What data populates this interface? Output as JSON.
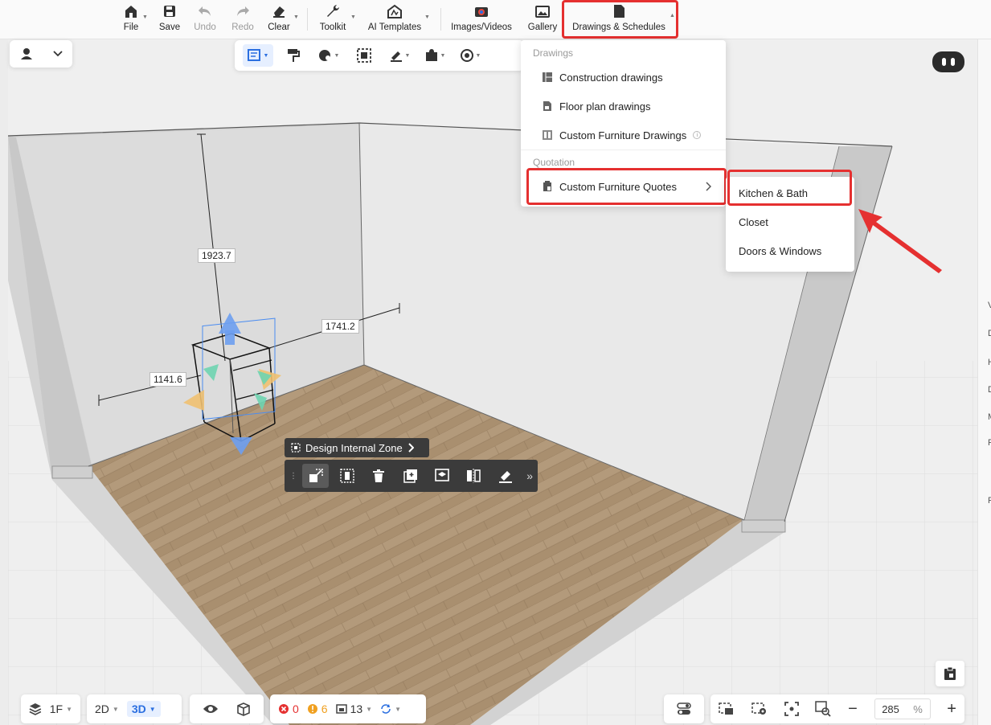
{
  "toolbar": {
    "file": "File",
    "save": "Save",
    "undo": "Undo",
    "redo": "Redo",
    "clear": "Clear",
    "toolkit": "Toolkit",
    "ai_templates": "AI Templates",
    "images_videos": "Images/Videos",
    "gallery": "Gallery",
    "drawings_schedules": "Drawings & Schedules"
  },
  "dimensions": {
    "height": "1923.7",
    "width": "1741.2",
    "depth": "1141.6"
  },
  "context_toolbar": {
    "zone_label": "Design Internal Zone"
  },
  "drawings_menu": {
    "section_drawings": "Drawings",
    "items": [
      {
        "label": "Construction drawings",
        "icon": "construction-drawings-icon"
      },
      {
        "label": "Floor plan drawings",
        "icon": "floor-plan-icon"
      },
      {
        "label": "Custom Furniture Drawings",
        "icon": "furniture-drawings-icon"
      }
    ],
    "section_quotation": "Quotation",
    "quotes_item": "Custom Furniture Quotes"
  },
  "quotes_submenu": {
    "items": [
      "Kitchen & Bath",
      "Closet",
      "Doors & Windows"
    ]
  },
  "bottom_bar": {
    "floor": "1F",
    "mode_2d": "2D",
    "mode_3d": "3D",
    "errors": "0",
    "warnings": "6",
    "items_count": "13",
    "zoom": "285",
    "zoom_unit": "%"
  },
  "right_strip_letters": [
    "V",
    "D",
    "H",
    "D",
    "M",
    "R",
    "P"
  ],
  "colors": {
    "accent": "#2b6fe0",
    "highlight": "#e53030",
    "toolbar_dark": "#3b3b3b"
  }
}
